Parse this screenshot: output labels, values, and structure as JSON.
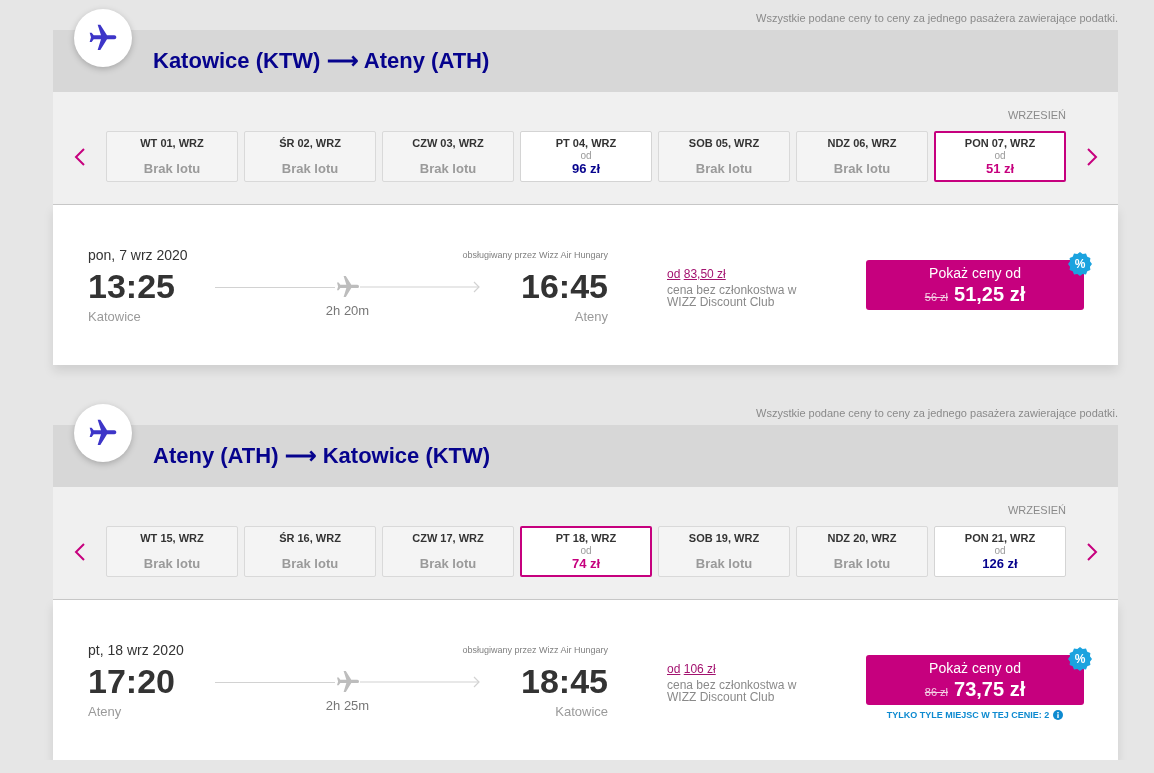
{
  "journeys": [
    {
      "price_note": "Wszystkie podane ceny to ceny za jednego pasażera zawierające podatki.",
      "route_title": "Katowice (KTW) ⟶ Ateny (ATH)",
      "date_strip": {
        "month": "WRZESIEŃ",
        "dates": [
          {
            "kind": "no-flight",
            "label": "WT 01, WRZ",
            "status": "Brak lotu",
            "selected": false
          },
          {
            "kind": "no-flight",
            "label": "ŚR 02, WRZ",
            "status": "Brak lotu",
            "selected": false
          },
          {
            "kind": "no-flight",
            "label": "CZW 03, WRZ",
            "status": "Brak lotu",
            "selected": false
          },
          {
            "kind": "fare",
            "label": "PT 04, WRZ",
            "prefix": "od",
            "price": "96 zł",
            "selected": false
          },
          {
            "kind": "no-flight",
            "label": "SOB 05, WRZ",
            "status": "Brak lotu",
            "selected": false
          },
          {
            "kind": "no-flight",
            "label": "NDZ 06, WRZ",
            "status": "Brak lotu",
            "selected": false
          },
          {
            "kind": "fare",
            "label": "PON 07, WRZ",
            "prefix": "od",
            "price": "51 zł",
            "selected": true
          }
        ]
      },
      "flight": {
        "date": "pon, 7 wrz 2020",
        "departure": {
          "time": "13:25",
          "city": "Katowice"
        },
        "duration": "2h 20m",
        "operator": "obsługiwany przez Wizz Air Hungary",
        "arrival": {
          "time": "16:45",
          "city": "Ateny"
        },
        "member_price": {
          "prefix": "od",
          "price": "83,50 zł",
          "note": "cena bez członkostwa w WIZZ Discount Club"
        },
        "price_button": {
          "label": "Pokaż ceny od",
          "old_price": "56 zł",
          "price": "51,25 zł"
        },
        "discount_badge": "%"
      }
    },
    {
      "price_note": "Wszystkie podane ceny to ceny za jednego pasażera zawierające podatki.",
      "route_title": "Ateny (ATH) ⟶ Katowice (KTW)",
      "date_strip": {
        "month": "WRZESIEŃ",
        "dates": [
          {
            "kind": "no-flight",
            "label": "WT 15, WRZ",
            "status": "Brak lotu",
            "selected": false
          },
          {
            "kind": "no-flight",
            "label": "ŚR 16, WRZ",
            "status": "Brak lotu",
            "selected": false
          },
          {
            "kind": "no-flight",
            "label": "CZW 17, WRZ",
            "status": "Brak lotu",
            "selected": false
          },
          {
            "kind": "fare",
            "label": "PT 18, WRZ",
            "prefix": "od",
            "price": "74 zł",
            "selected": true
          },
          {
            "kind": "no-flight",
            "label": "SOB 19, WRZ",
            "status": "Brak lotu",
            "selected": false
          },
          {
            "kind": "no-flight",
            "label": "NDZ 20, WRZ",
            "status": "Brak lotu",
            "selected": false
          },
          {
            "kind": "fare",
            "label": "PON 21, WRZ",
            "prefix": "od",
            "price": "126 zł",
            "selected": false
          }
        ]
      },
      "flight": {
        "date": "pt, 18 wrz 2020",
        "departure": {
          "time": "17:20",
          "city": "Ateny"
        },
        "duration": "2h 25m",
        "operator": "obsługiwany przez Wizz Air Hungary",
        "arrival": {
          "time": "18:45",
          "city": "Katowice"
        },
        "member_price": {
          "prefix": "od",
          "price": "106 zł",
          "note": "cena bez członkostwa w WIZZ Discount Club"
        },
        "price_button": {
          "label": "Pokaż ceny od",
          "old_price": "86 zł",
          "price": "73,75 zł"
        },
        "discount_badge": "%",
        "seats_warning": "TYLKO TYLE MIEJSC W TEJ CENIE: 2"
      }
    }
  ]
}
